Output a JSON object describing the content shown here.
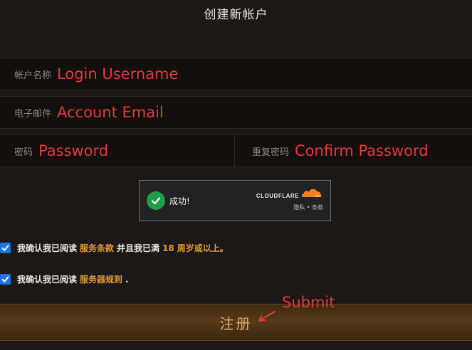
{
  "page": {
    "title": "创建新帐户"
  },
  "form": {
    "username": {
      "label": "帐户名称",
      "placeholder": "Login Username"
    },
    "email": {
      "label": "电子邮件",
      "placeholder": "Account Email"
    },
    "password": {
      "label": "密码",
      "placeholder": "Password"
    },
    "confirm_password": {
      "label": "重复密码",
      "placeholder": "Confirm Password"
    }
  },
  "captcha": {
    "status": "成功!",
    "brand": "CLOUDFLARE",
    "privacy": "隐私",
    "separator": "•",
    "terms": "条款"
  },
  "agreements": {
    "tos": {
      "prefix": "我确认我已阅读",
      "link": "服务条款",
      "middle": "并且我已满",
      "age": "18",
      "suffix": "周岁或以上。",
      "checked": true
    },
    "rules": {
      "prefix": "我确认我已阅读",
      "link": "服务器规则",
      "suffix": ".",
      "checked": true
    }
  },
  "submit": {
    "label": "注册",
    "annotation": "Submit"
  },
  "colors": {
    "accent": "#e39a39",
    "annotation_red": "#e33a3a",
    "checkbox_blue": "#1a73e8",
    "success_green": "#1e9e49"
  }
}
